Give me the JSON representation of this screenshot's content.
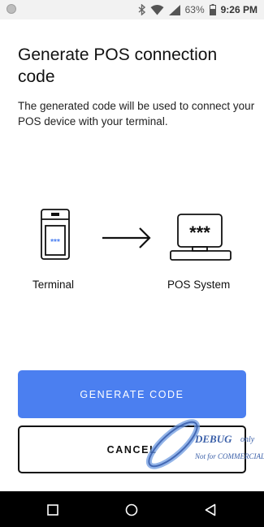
{
  "status_bar": {
    "battery_text": "63%",
    "time": "9:26",
    "ampm": "PM",
    "icons": [
      "notification-dot-icon",
      "bluetooth-icon",
      "wifi-icon",
      "signal-icon",
      "battery-icon"
    ]
  },
  "header": {
    "title": "Generate POS connection code",
    "subtitle": "The generated code will be used to connect your POS device with your terminal."
  },
  "illustration": {
    "terminal_label": "Terminal",
    "terminal_screen_text": "***",
    "pos_label": "POS System",
    "pos_screen_text": "***",
    "terminal_text_color": "#4b7ff0"
  },
  "actions": {
    "generate_label": "GENERATE CODE",
    "cancel_label": "CANCEL"
  },
  "watermark": {
    "line1": "DEBUG",
    "line1_suffix": "only",
    "line2": "Not for COMMERCIAL"
  },
  "nav_bar": {
    "icons": [
      "recent-apps-icon",
      "home-icon",
      "back-icon"
    ]
  },
  "colors": {
    "accent": "#4b7ff0",
    "status_bar_bg": "#f2f2f2",
    "nav_bar_bg": "#000000"
  }
}
